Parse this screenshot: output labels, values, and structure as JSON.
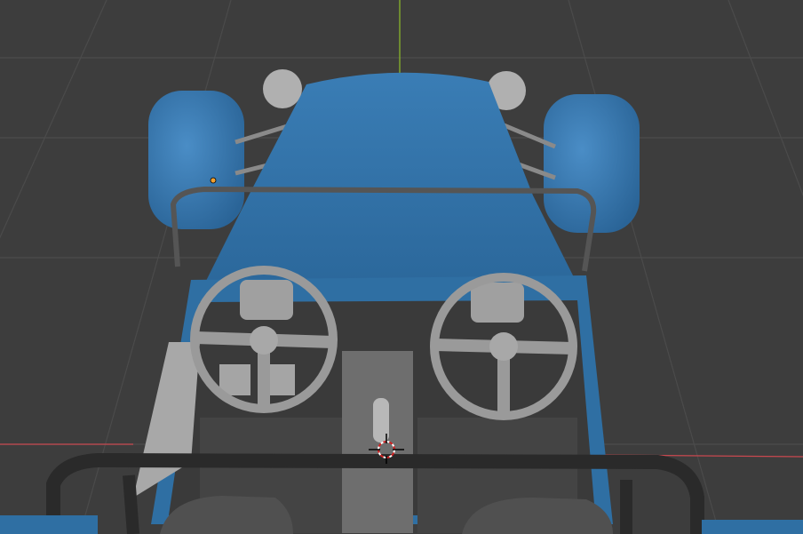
{
  "viewport": {
    "mode": "3d-viewport",
    "colors": {
      "background": "#3d3d3d",
      "grid": "#4b4b4b",
      "axis_y": "#8fbf2a",
      "axis_x": "#c8484f",
      "body_blue": "#2f6fa3",
      "body_blue_light": "#3f86bf",
      "interior_gray": "#9a9a9a",
      "frame_dark": "#2a2a2a",
      "origin_dot": "#f0a030"
    }
  }
}
